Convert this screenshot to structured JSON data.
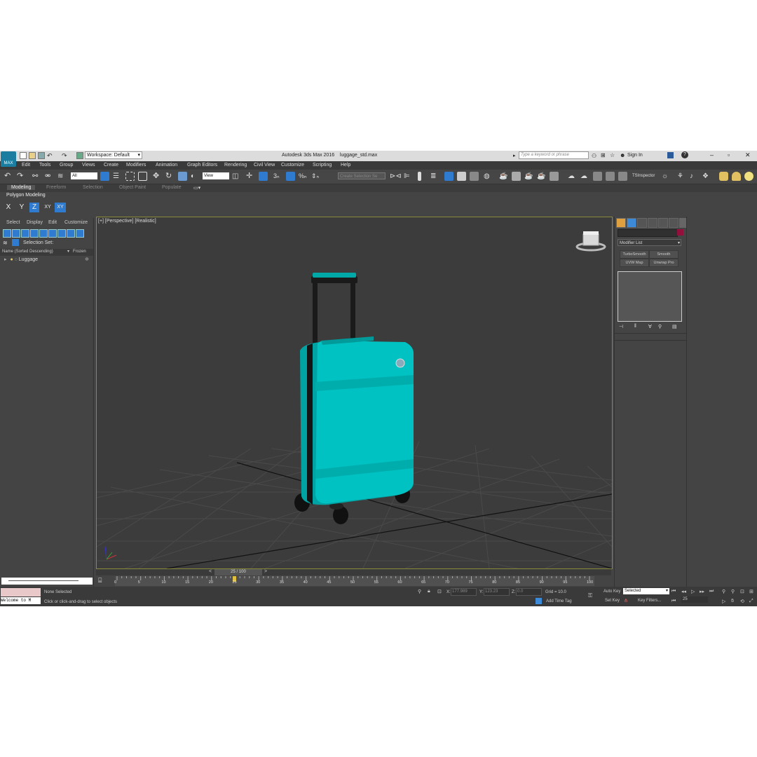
{
  "app": {
    "title": "Autodesk 3ds Max 2016",
    "file": "luggage_std.max",
    "logo_text": "MAX",
    "workspace": "Workspace: Default",
    "search_placeholder": "Type a keyword or phrase",
    "sign_in": "Sign In"
  },
  "menus": [
    "Edit",
    "Tools",
    "Group",
    "Views",
    "Create",
    "Modifiers",
    "Animation",
    "Graph Editors",
    "Rendering",
    "Civil View",
    "Customize",
    "Scripting",
    "Help"
  ],
  "toolbar": {
    "filter": "All",
    "ref_coord": "View",
    "selection_set": "Create Selection Se",
    "ts_inspector": "TSInspector"
  },
  "ribbon": {
    "tabs": [
      "Modeling",
      "Freeform",
      "Selection",
      "Object Paint",
      "Populate"
    ],
    "panel": "Polygon Modeling"
  },
  "axis_constraints": [
    "X",
    "Y",
    "Z",
    "XY",
    "XY"
  ],
  "scene_explorer": {
    "menus": [
      "Select",
      "Display",
      "Edit",
      "Customize"
    ],
    "selection_set_label": "Selection Set:",
    "column_name": "Name (Sorted Descending)",
    "column_frozen": "Frozen",
    "items": [
      "Luggage"
    ]
  },
  "viewport": {
    "label": "[+] [Perspective] [Realistic]",
    "object_color": "#00bfbf"
  },
  "command_panel": {
    "modifier_list": "Modifier List",
    "object_color": "#94103c",
    "buttons": [
      "TurboSmooth",
      "Smooth",
      "UVW Map",
      "Unwrap Pro"
    ]
  },
  "timeline": {
    "frame": "25 / 100",
    "ticks": [
      "0",
      "5",
      "10",
      "15",
      "20",
      "25",
      "30",
      "35",
      "40",
      "45",
      "50",
      "55",
      "60",
      "65",
      "70",
      "75",
      "80",
      "85",
      "90",
      "95",
      "100"
    ]
  },
  "status": {
    "selected": "None Selected",
    "prompt": "Click or click-and-drag to select objects",
    "x_label": "X:",
    "x": "177.989",
    "y_label": "Y:",
    "y": "123.23",
    "z_label": "Z:",
    "z": "0.0",
    "grid": "Grid = 10.0",
    "add_time_tag": "Add Time Tag",
    "auto_key": "Auto Key",
    "auto_key_value": "Selected",
    "set_key": "Set Key",
    "key_filters": "Key Filters...",
    "current_frame": "25",
    "listener": "Welcome to M"
  }
}
